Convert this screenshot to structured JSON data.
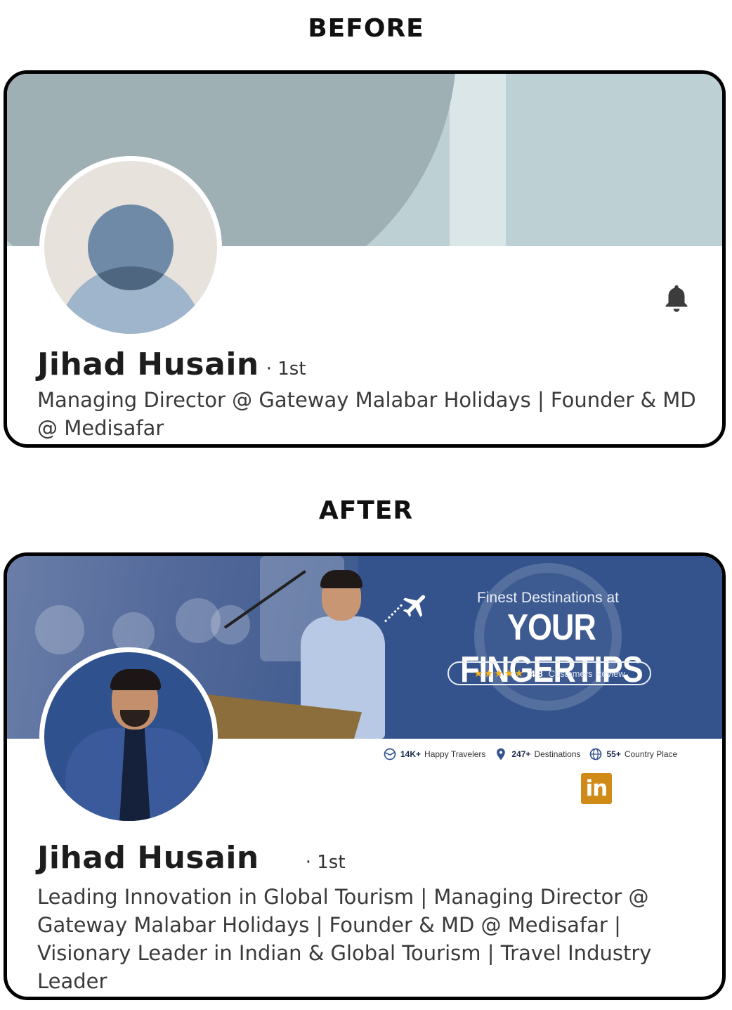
{
  "before": {
    "section_title": "BEFORE",
    "profile": {
      "name": "Jihad Husain",
      "degree": "· 1st",
      "headline": "Managing Director @ Gateway Malabar Holidays | Founder & MD @ Medisafar"
    },
    "icons": {
      "avatar": "default-avatar-placeholder",
      "action": "bell-icon"
    }
  },
  "after": {
    "section_title": "AFTER",
    "profile": {
      "name": "Jihad Husain",
      "degree": "· 1st",
      "headline": "Leading Innovation in Global Tourism | Managing Director @ Gateway Malabar Holidays | Founder & MD @ Medisafar | Visionary Leader in Indian & Global Tourism | Travel Industry Leader"
    },
    "banner": {
      "subtitle": "Finest Destinations at",
      "title": "YOUR FINGERTIPS",
      "review": {
        "stars": "★★★★★",
        "rating": "4.8",
        "label": "Customers Review"
      },
      "stats": [
        {
          "value": "14K+",
          "label": "Happy Travelers",
          "icon": "globe-travel-icon"
        },
        {
          "value": "247+",
          "label": "Destinations",
          "icon": "map-pin-icon"
        },
        {
          "value": "55+",
          "label": "Country Place",
          "icon": "world-icon"
        }
      ],
      "colors": {
        "background": "#34538c",
        "star": "#f2b21c"
      }
    },
    "icons": {
      "action": "linkedin-icon",
      "action_text": "in",
      "action_color": "#d08a18"
    }
  }
}
